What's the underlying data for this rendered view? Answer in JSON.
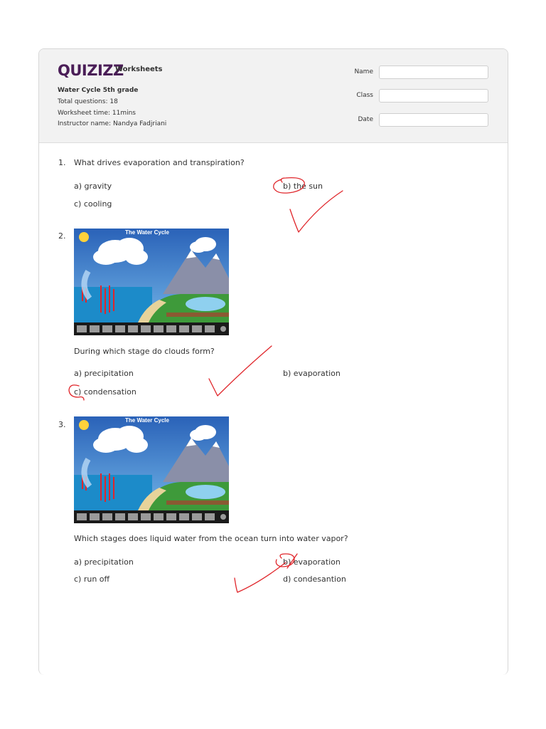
{
  "header": {
    "logo": "QUIZIZZ",
    "product": "Worksheets",
    "worksheet_title": "Water Cycle 5th grade",
    "total_questions": "Total questions: 18",
    "worksheet_time": "Worksheet time: 11mins",
    "instructor": "Instructor name: Nandya Fadjriani",
    "fields": {
      "name_label": "Name",
      "class_label": "Class",
      "date_label": "Date"
    }
  },
  "questions": [
    {
      "number": "1.",
      "text": "What drives evaporation and transpiration?",
      "options": [
        "a)  gravity",
        "b)  the sun",
        "c)  cooling"
      ]
    },
    {
      "number": "2.",
      "image_title": "The Water Cycle",
      "text": "During which stage do clouds form?",
      "options": [
        "a)  precipitation",
        "b)  evaporation",
        "c)  condensation"
      ]
    },
    {
      "number": "3.",
      "image_title": "The Water Cycle",
      "text": "Which stages does liquid water from the ocean turn into water vapor?",
      "options": [
        "a)  precipitation",
        "b)  evaporation",
        "c)  run off",
        "d)  condesantion"
      ]
    }
  ],
  "colors": {
    "logo": "#4a1d57",
    "ink_marks": "#e0262b",
    "sky": "#2c6fc0",
    "sea": "#1c8bc9"
  }
}
